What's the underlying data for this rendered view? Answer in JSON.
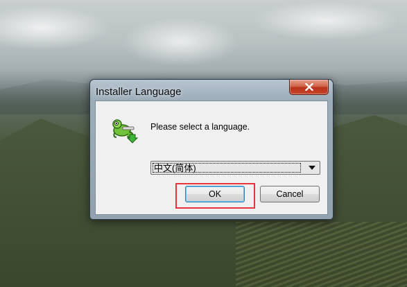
{
  "window": {
    "title": "Installer Language",
    "close_icon": "close-icon"
  },
  "dialog": {
    "prompt": "Please select a language.",
    "app_icon": "installer-app-icon",
    "language_select": {
      "selected": "中文(简体)"
    },
    "buttons": {
      "ok": "OK",
      "cancel": "Cancel"
    }
  },
  "annotation": {
    "highlight_color": "#e8343b",
    "highlight_target": "ok-button"
  },
  "colors": {
    "close_button": "#c8452b",
    "focus_border": "#3c7fb1"
  }
}
